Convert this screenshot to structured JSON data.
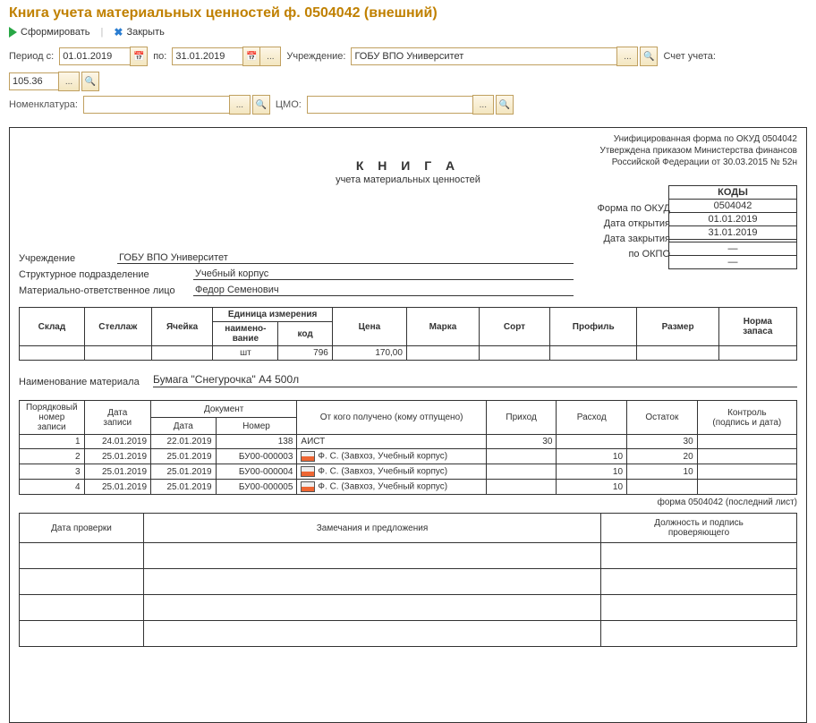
{
  "window": {
    "title": "Книга учета материальных ценностей ф. 0504042 (внешний)"
  },
  "toolbar": {
    "form": "Сформировать",
    "close": "Закрыть"
  },
  "params": {
    "period_label": "Период с:",
    "date_from": "01.01.2019",
    "to_label": "по:",
    "date_to": "31.01.2019",
    "org_label": "Учреждение:",
    "org": "ГОБУ ВПО Университет",
    "acc_label": "Счет учета:",
    "acc": "105.36",
    "nom_label": "Номенклатура:",
    "nom": "",
    "cmo_label": "ЦМО:",
    "cmo": ""
  },
  "report": {
    "meta1": "Унифицированная форма по ОКУД 0504042",
    "meta2": "Утверждена приказом Министерства финансов",
    "meta3": "Российской Федерации от 30.03.2015 № 52н",
    "title_big": "К Н И Г А",
    "title_sub": "учета материальных ценностей",
    "codes": {
      "header": "КОДЫ",
      "okud_label": "Форма по ОКУД",
      "okud": "0504042",
      "open_label": "Дата открытия",
      "open": "01.01.2019",
      "close_label": "Дата закрытия",
      "close": "31.01.2019",
      "okpo_label": "по ОКПО",
      "okpo": "",
      "dash1": "—",
      "dash2": "—"
    },
    "org": {
      "inst_label": "Учреждение",
      "inst": "ГОБУ ВПО Университет",
      "dept_label": "Структурное подразделение",
      "dept": "Учебный корпус",
      "mol_label": "Материально-ответственное лицо",
      "mol": "Федор Семенович"
    },
    "dim": {
      "hdr_sklad": "Склад",
      "hdr_stell": "Стеллаж",
      "hdr_yach": "Ячейка",
      "hdr_unit": "Единица измерения",
      "hdr_unit_name": "наимено-\nвание",
      "hdr_unit_code": "код",
      "hdr_price": "Цена",
      "hdr_marka": "Марка",
      "hdr_sort": "Сорт",
      "hdr_profile": "Профиль",
      "hdr_size": "Размер",
      "hdr_norm": "Норма\nзапаса",
      "unit_name": "шт",
      "unit_code": "796",
      "price": "170,00"
    },
    "mat": {
      "label": "Наименование материала",
      "value": "Бумага \"Снегурочка\" А4 500л"
    },
    "mov_hdr": {
      "seq": "Порядковый\nномер\nзаписи",
      "rec_date": "Дата\nзаписи",
      "doc": "Документ",
      "doc_date": "Дата",
      "doc_num": "Номер",
      "who": "От кого получено (кому отпущено)",
      "prihod": "Приход",
      "rashod": "Расход",
      "ostatok": "Остаток",
      "ctrl": "Контроль\n(подпись и дата)"
    },
    "mov": [
      {
        "n": "1",
        "rd": "24.01.2019",
        "dd": "22.01.2019",
        "dn": "138",
        "who": "АИСТ",
        "in": "30",
        "out": "",
        "bal": "30"
      },
      {
        "n": "2",
        "rd": "25.01.2019",
        "dd": "25.01.2019",
        "dn": "БУ00-000003",
        "who": "Ф. С. (Завхоз, Учебный корпус)",
        "in": "",
        "out": "10",
        "bal": "20",
        "icon": true
      },
      {
        "n": "3",
        "rd": "25.01.2019",
        "dd": "25.01.2019",
        "dn": "БУ00-000004",
        "who": "Ф. С. (Завхоз, Учебный корпус)",
        "in": "",
        "out": "10",
        "bal": "10",
        "icon": true
      },
      {
        "n": "4",
        "rd": "25.01.2019",
        "dd": "25.01.2019",
        "dn": "БУ00-000005",
        "who": "Ф. С. (Завхоз, Учебный корпус)",
        "in": "",
        "out": "10",
        "bal": "",
        "icon": true
      }
    ],
    "foot_note": "форма 0504042 (последний лист)",
    "audit_hdr": {
      "date": "Дата проверки",
      "notes": "Замечания и предложения",
      "sign": "Должность и подпись\nпроверяющего"
    }
  }
}
